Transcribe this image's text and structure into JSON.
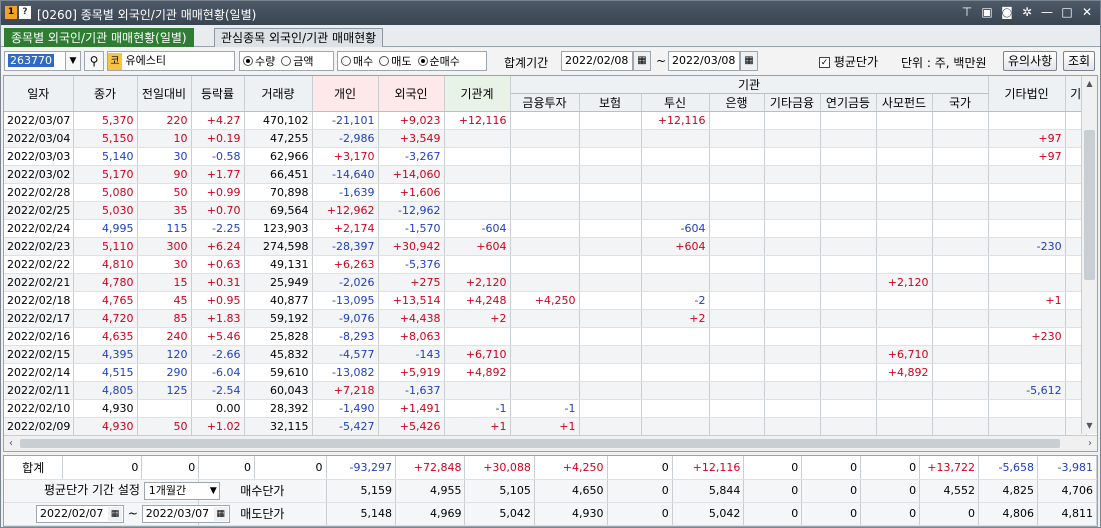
{
  "window": {
    "badge1": "1",
    "badge2": "?",
    "title": "[0260] 종목별 외국인/기관 매매현황(일별)",
    "icons": [
      "pin-icon",
      "export-icon",
      "screenshot-icon",
      "settings-icon",
      "minimize-icon",
      "maximize-icon",
      "close-icon"
    ]
  },
  "tabs": [
    {
      "label": "종목별 외국인/기관 매매현황(일별)",
      "active": true
    },
    {
      "label": "관심종목 외국인/기관 매매현황",
      "active": false
    }
  ],
  "toolbar": {
    "stock_code": "263770",
    "market_badge": "코",
    "stock_name": "유에스티",
    "unit_type_options": [
      {
        "label": "수량",
        "selected": true
      },
      {
        "label": "금액",
        "selected": false
      }
    ],
    "trade_type_options": [
      {
        "label": "매수",
        "selected": false
      },
      {
        "label": "매도",
        "selected": false
      },
      {
        "label": "순매수",
        "selected": true
      }
    ],
    "period_label": "합계기간",
    "start_date": "2022/02/08",
    "tilde": "~",
    "end_date": "2022/03/08",
    "avg_price_check": "✓",
    "avg_price_label": "평균단가",
    "unit_label": "단위 : 주, 백만원",
    "notice_button": "유의사항",
    "query_button": "조회"
  },
  "grid": {
    "headers_top": {
      "date": "일자",
      "close": "종가",
      "change": "전일대비",
      "rate": "등락률",
      "volume": "거래량",
      "individual": "개인",
      "foreign": "외국인",
      "inst_total": "기관계",
      "inst_group": "기관",
      "other_corp": "기타법인",
      "extra": "기"
    },
    "inst_sub": [
      "금융투자",
      "보험",
      "투신",
      "은행",
      "기타금융",
      "연기금등",
      "사모펀드",
      "국가"
    ],
    "rows": [
      {
        "date": "2022/03/07",
        "close": "5,370",
        "close_c": "red",
        "change": "220",
        "change_c": "red",
        "rate": "+4.27",
        "rate_c": "red",
        "volume": "470,102",
        "indiv": "-21,101",
        "indiv_c": "blue",
        "foreign": "+9,023",
        "foreign_c": "red",
        "inst": "+12,116",
        "inst_c": "red",
        "fin": "",
        "ins": "",
        "trust": "+12,116",
        "trust_c": "red",
        "bank": "",
        "etcfin": "",
        "pension": "",
        "pef": "",
        "nation": "",
        "corp": "",
        "corp_c": ""
      },
      {
        "date": "2022/03/04",
        "close": "5,150",
        "close_c": "red",
        "change": "10",
        "change_c": "red",
        "rate": "+0.19",
        "rate_c": "red",
        "volume": "47,255",
        "indiv": "-2,986",
        "indiv_c": "blue",
        "foreign": "+3,549",
        "foreign_c": "red",
        "inst": "",
        "inst_c": "",
        "fin": "",
        "ins": "",
        "trust": "",
        "trust_c": "",
        "bank": "",
        "etcfin": "",
        "pension": "",
        "pef": "",
        "nation": "",
        "corp": "+97",
        "corp_c": "red"
      },
      {
        "date": "2022/03/03",
        "close": "5,140",
        "close_c": "blue",
        "change": "30",
        "change_c": "blue",
        "rate": "-0.58",
        "rate_c": "blue",
        "volume": "62,966",
        "indiv": "+3,170",
        "indiv_c": "red",
        "foreign": "-3,267",
        "foreign_c": "blue",
        "inst": "",
        "inst_c": "",
        "fin": "",
        "ins": "",
        "trust": "",
        "trust_c": "",
        "bank": "",
        "etcfin": "",
        "pension": "",
        "pef": "",
        "nation": "",
        "corp": "+97",
        "corp_c": "red"
      },
      {
        "date": "2022/03/02",
        "close": "5,170",
        "close_c": "red",
        "change": "90",
        "change_c": "red",
        "rate": "+1.77",
        "rate_c": "red",
        "volume": "66,451",
        "indiv": "-14,640",
        "indiv_c": "blue",
        "foreign": "+14,060",
        "foreign_c": "red",
        "inst": "",
        "inst_c": "",
        "fin": "",
        "ins": "",
        "trust": "",
        "trust_c": "",
        "bank": "",
        "etcfin": "",
        "pension": "",
        "pef": "",
        "nation": "",
        "corp": "",
        "corp_c": ""
      },
      {
        "date": "2022/02/28",
        "close": "5,080",
        "close_c": "red",
        "change": "50",
        "change_c": "red",
        "rate": "+0.99",
        "rate_c": "red",
        "volume": "70,898",
        "indiv": "-1,639",
        "indiv_c": "blue",
        "foreign": "+1,606",
        "foreign_c": "red",
        "inst": "",
        "inst_c": "",
        "fin": "",
        "ins": "",
        "trust": "",
        "trust_c": "",
        "bank": "",
        "etcfin": "",
        "pension": "",
        "pef": "",
        "nation": "",
        "corp": "",
        "corp_c": ""
      },
      {
        "date": "2022/02/25",
        "close": "5,030",
        "close_c": "red",
        "change": "35",
        "change_c": "red",
        "rate": "+0.70",
        "rate_c": "red",
        "volume": "69,564",
        "indiv": "+12,962",
        "indiv_c": "red",
        "foreign": "-12,962",
        "foreign_c": "blue",
        "inst": "",
        "inst_c": "",
        "fin": "",
        "ins": "",
        "trust": "",
        "trust_c": "",
        "bank": "",
        "etcfin": "",
        "pension": "",
        "pef": "",
        "nation": "",
        "corp": "",
        "corp_c": ""
      },
      {
        "date": "2022/02/24",
        "close": "4,995",
        "close_c": "blue",
        "change": "115",
        "change_c": "blue",
        "rate": "-2.25",
        "rate_c": "blue",
        "volume": "123,903",
        "indiv": "+2,174",
        "indiv_c": "red",
        "foreign": "-1,570",
        "foreign_c": "blue",
        "inst": "-604",
        "inst_c": "blue",
        "fin": "",
        "ins": "",
        "trust": "-604",
        "trust_c": "blue",
        "bank": "",
        "etcfin": "",
        "pension": "",
        "pef": "",
        "nation": "",
        "corp": "",
        "corp_c": ""
      },
      {
        "date": "2022/02/23",
        "close": "5,110",
        "close_c": "red",
        "change": "300",
        "change_c": "red",
        "rate": "+6.24",
        "rate_c": "red",
        "volume": "274,598",
        "indiv": "-28,397",
        "indiv_c": "blue",
        "foreign": "+30,942",
        "foreign_c": "red",
        "inst": "+604",
        "inst_c": "red",
        "fin": "",
        "ins": "",
        "trust": "+604",
        "trust_c": "red",
        "bank": "",
        "etcfin": "",
        "pension": "",
        "pef": "",
        "nation": "",
        "corp": "-230",
        "corp_c": "blue"
      },
      {
        "date": "2022/02/22",
        "close": "4,810",
        "close_c": "red",
        "change": "30",
        "change_c": "red",
        "rate": "+0.63",
        "rate_c": "red",
        "volume": "49,131",
        "indiv": "+6,263",
        "indiv_c": "red",
        "foreign": "-5,376",
        "foreign_c": "blue",
        "inst": "",
        "inst_c": "",
        "fin": "",
        "ins": "",
        "trust": "",
        "trust_c": "",
        "bank": "",
        "etcfin": "",
        "pension": "",
        "pef": "",
        "nation": "",
        "corp": "",
        "corp_c": ""
      },
      {
        "date": "2022/02/21",
        "close": "4,780",
        "close_c": "red",
        "change": "15",
        "change_c": "red",
        "rate": "+0.31",
        "rate_c": "red",
        "volume": "25,949",
        "indiv": "-2,026",
        "indiv_c": "blue",
        "foreign": "+275",
        "foreign_c": "red",
        "inst": "+2,120",
        "inst_c": "red",
        "fin": "",
        "ins": "",
        "trust": "",
        "trust_c": "",
        "bank": "",
        "etcfin": "",
        "pension": "",
        "pef": "+2,120",
        "nation": "",
        "corp": "",
        "corp_c": ""
      },
      {
        "date": "2022/02/18",
        "close": "4,765",
        "close_c": "red",
        "change": "45",
        "change_c": "red",
        "rate": "+0.95",
        "rate_c": "red",
        "volume": "40,877",
        "indiv": "-13,095",
        "indiv_c": "blue",
        "foreign": "+13,514",
        "foreign_c": "red",
        "inst": "+4,248",
        "inst_c": "red",
        "fin": "+4,250",
        "ins": "",
        "trust": "-2",
        "trust_c": "blue",
        "bank": "",
        "etcfin": "",
        "pension": "",
        "pef": "",
        "nation": "",
        "corp": "+1",
        "corp_c": "red"
      },
      {
        "date": "2022/02/17",
        "close": "4,720",
        "close_c": "red",
        "change": "85",
        "change_c": "red",
        "rate": "+1.83",
        "rate_c": "red",
        "volume": "59,192",
        "indiv": "-9,076",
        "indiv_c": "blue",
        "foreign": "+4,438",
        "foreign_c": "red",
        "inst": "+2",
        "inst_c": "red",
        "fin": "",
        "ins": "",
        "trust": "+2",
        "trust_c": "red",
        "bank": "",
        "etcfin": "",
        "pension": "",
        "pef": "",
        "nation": "",
        "corp": "",
        "corp_c": ""
      },
      {
        "date": "2022/02/16",
        "close": "4,635",
        "close_c": "red",
        "change": "240",
        "change_c": "red",
        "rate": "+5.46",
        "rate_c": "red",
        "volume": "25,828",
        "indiv": "-8,293",
        "indiv_c": "blue",
        "foreign": "+8,063",
        "foreign_c": "red",
        "inst": "",
        "inst_c": "",
        "fin": "",
        "ins": "",
        "trust": "",
        "trust_c": "",
        "bank": "",
        "etcfin": "",
        "pension": "",
        "pef": "",
        "nation": "",
        "corp": "+230",
        "corp_c": "red"
      },
      {
        "date": "2022/02/15",
        "close": "4,395",
        "close_c": "blue",
        "change": "120",
        "change_c": "blue",
        "rate": "-2.66",
        "rate_c": "blue",
        "volume": "45,832",
        "indiv": "-4,577",
        "indiv_c": "blue",
        "foreign": "-143",
        "foreign_c": "blue",
        "inst": "+6,710",
        "inst_c": "red",
        "fin": "",
        "ins": "",
        "trust": "",
        "trust_c": "",
        "bank": "",
        "etcfin": "",
        "pension": "",
        "pef": "+6,710",
        "nation": "",
        "corp": "",
        "corp_c": ""
      },
      {
        "date": "2022/02/14",
        "close": "4,515",
        "close_c": "blue",
        "change": "290",
        "change_c": "blue",
        "rate": "-6.04",
        "rate_c": "blue",
        "volume": "59,610",
        "indiv": "-13,082",
        "indiv_c": "blue",
        "foreign": "+5,919",
        "foreign_c": "red",
        "inst": "+4,892",
        "inst_c": "red",
        "fin": "",
        "ins": "",
        "trust": "",
        "trust_c": "",
        "bank": "",
        "etcfin": "",
        "pension": "",
        "pef": "+4,892",
        "nation": "",
        "corp": "",
        "corp_c": ""
      },
      {
        "date": "2022/02/11",
        "close": "4,805",
        "close_c": "blue",
        "change": "125",
        "change_c": "blue",
        "rate": "-2.54",
        "rate_c": "blue",
        "volume": "60,043",
        "indiv": "+7,218",
        "indiv_c": "red",
        "foreign": "-1,637",
        "foreign_c": "blue",
        "inst": "",
        "inst_c": "",
        "fin": "",
        "ins": "",
        "trust": "",
        "trust_c": "",
        "bank": "",
        "etcfin": "",
        "pension": "",
        "pef": "",
        "nation": "",
        "corp": "-5,612",
        "corp_c": "blue"
      },
      {
        "date": "2022/02/10",
        "close": "4,930",
        "close_c": "",
        "change": "",
        "change_c": "",
        "rate": "0.00",
        "rate_c": "",
        "volume": "28,392",
        "indiv": "-1,490",
        "indiv_c": "blue",
        "foreign": "+1,491",
        "foreign_c": "red",
        "inst": "-1",
        "inst_c": "blue",
        "fin": "-1",
        "ins": "",
        "trust": "",
        "trust_c": "",
        "bank": "",
        "etcfin": "",
        "pension": "",
        "pef": "",
        "nation": "",
        "corp": "",
        "corp_c": ""
      },
      {
        "date": "2022/02/09",
        "close": "4,930",
        "close_c": "red",
        "change": "50",
        "change_c": "red",
        "rate": "+1.02",
        "rate_c": "red",
        "volume": "32,115",
        "indiv": "-5,427",
        "indiv_c": "blue",
        "foreign": "+5,426",
        "foreign_c": "red",
        "inst": "+1",
        "inst_c": "red",
        "fin": "+1",
        "ins": "",
        "trust": "",
        "trust_c": "",
        "bank": "",
        "etcfin": "",
        "pension": "",
        "pef": "",
        "nation": "",
        "corp": "",
        "corp_c": ""
      }
    ]
  },
  "footer": {
    "sum_label": "합계",
    "sum": [
      "0",
      "0",
      "0",
      "0",
      "-93,297",
      "+72,848",
      "+30,088",
      "+4,250",
      "0",
      "+12,116",
      "0",
      "0",
      "0",
      "+13,722",
      "-5,658",
      "-3,981"
    ],
    "sum_colors": [
      "",
      "",
      "",
      "",
      "blue",
      "red",
      "red",
      "red",
      "",
      "red",
      "",
      "",
      "",
      "red",
      "blue",
      "blue"
    ],
    "avg_period_label": "평균단가 기간 설정",
    "avg_period_value": "1개월간",
    "buy_label": "매수단가",
    "buy": [
      "5,159",
      "4,955",
      "5,105",
      "4,650",
      "0",
      "5,844",
      "0",
      "0",
      "0",
      "4,552",
      "4,825",
      "4,706"
    ],
    "from_date": "2022/02/07",
    "to_date": "2022/03/07",
    "sell_label": "매도단가",
    "sell": [
      "5,148",
      "4,969",
      "5,042",
      "4,930",
      "0",
      "5,042",
      "0",
      "0",
      "0",
      "0",
      "4,806",
      "4,811"
    ]
  },
  "colors": {
    "up": "#d0021b",
    "down": "#1f3fbf",
    "tab_active": "#2e7d32"
  }
}
